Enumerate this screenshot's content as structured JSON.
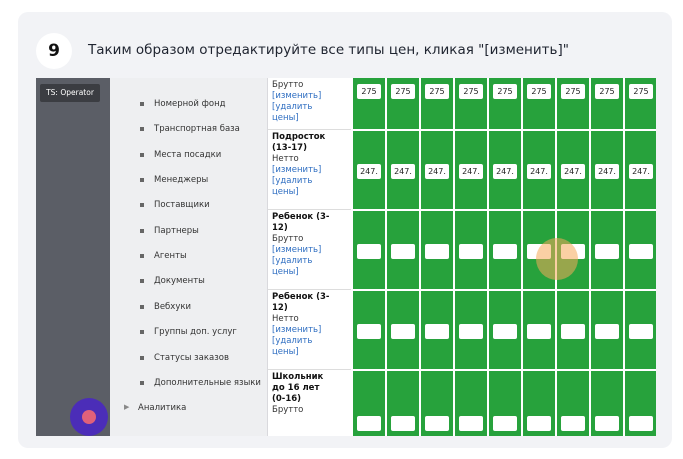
{
  "step": {
    "number": "9",
    "title": "Таким образом отредактируйте все типы цен, кликая \"[изменить]\""
  },
  "operator_badge": "TS: Operator",
  "menu": {
    "items": [
      "Номерной фонд",
      "Транспортная база",
      "Места посадки",
      "Менеджеры",
      "Поставщики",
      "Партнеры",
      "Агенты",
      "Документы",
      "Вебхуки",
      "Группы доп. услуг",
      "Статусы заказов",
      "Дополнительные языки"
    ],
    "group": "Аналитика"
  },
  "rows": [
    {
      "lines": [
        "Брутто"
      ],
      "edit": "[изменить]",
      "delete1": "[удалить",
      "delete2": "цены]"
    },
    {
      "name1": "Подросток",
      "name2": "(13-17)",
      "kind": "Нетто",
      "edit": "[изменить]",
      "delete1": "[удалить",
      "delete2": "цены]"
    },
    {
      "name1": "Ребенок (3-",
      "name2": "12)",
      "kind": "Брутто",
      "edit": "[изменить]",
      "delete1": "[удалить",
      "delete2": "цены]"
    },
    {
      "name1": "Ребенок (3-",
      "name2": "12)",
      "kind": "Нетто",
      "edit": "[изменить]",
      "delete1": "[удалить",
      "delete2": "цены]"
    },
    {
      "name1": "Школьник",
      "name2": "до 16 лет",
      "name3": "(0-16)",
      "kind": "Брутто"
    }
  ],
  "cell_values": {
    "row1": "275",
    "row2": "247."
  }
}
